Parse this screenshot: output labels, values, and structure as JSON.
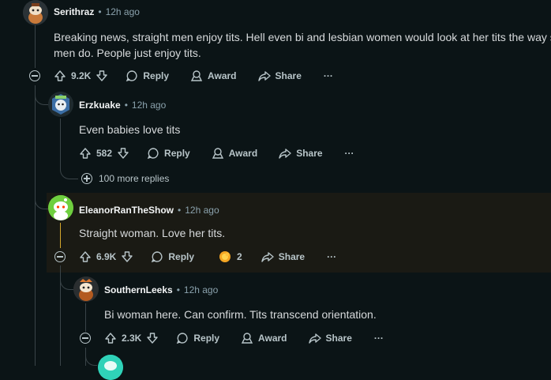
{
  "comments": [
    {
      "username": "Serithraz",
      "time": "12h ago",
      "body": "Breaking news, straight men enjoy tits. Hell even bi and lesbian women would look at her tits the way s men do. People just enjoy tits.",
      "score": "9.2K",
      "reply_label": "Reply",
      "award_label": "Award",
      "share_label": "Share",
      "more_label": "···",
      "avatar_icon": "snoo-avatar-orange"
    },
    {
      "username": "Erzkuake",
      "time": "12h ago",
      "body": "Even babies love tits",
      "score": "582",
      "reply_label": "Reply",
      "award_label": "Award",
      "share_label": "Share",
      "more_label": "···",
      "more_replies": "100 more replies",
      "avatar_icon": "snoo-avatar-blue"
    },
    {
      "username": "EleanorRanTheShow",
      "time": "12h ago",
      "body": "Straight woman. Love her tits.",
      "score": "6.9K",
      "reply_label": "Reply",
      "award_count": "2",
      "share_label": "Share",
      "more_label": "···",
      "avatar_icon": "snoo-avatar-green"
    },
    {
      "username": "SouthernLeeks",
      "time": "12h ago",
      "body": "Bi woman here. Can confirm. Tits transcend orientation.",
      "score": "2.3K",
      "reply_label": "Reply",
      "award_label": "Award",
      "share_label": "Share",
      "more_label": "···",
      "avatar_icon": "snoo-avatar-orange-dark"
    }
  ],
  "colors": {
    "background": "#0b1416",
    "highlight": "#1a1a14",
    "thread_line": "#3a4448",
    "highlight_line": "#d4a72c"
  }
}
